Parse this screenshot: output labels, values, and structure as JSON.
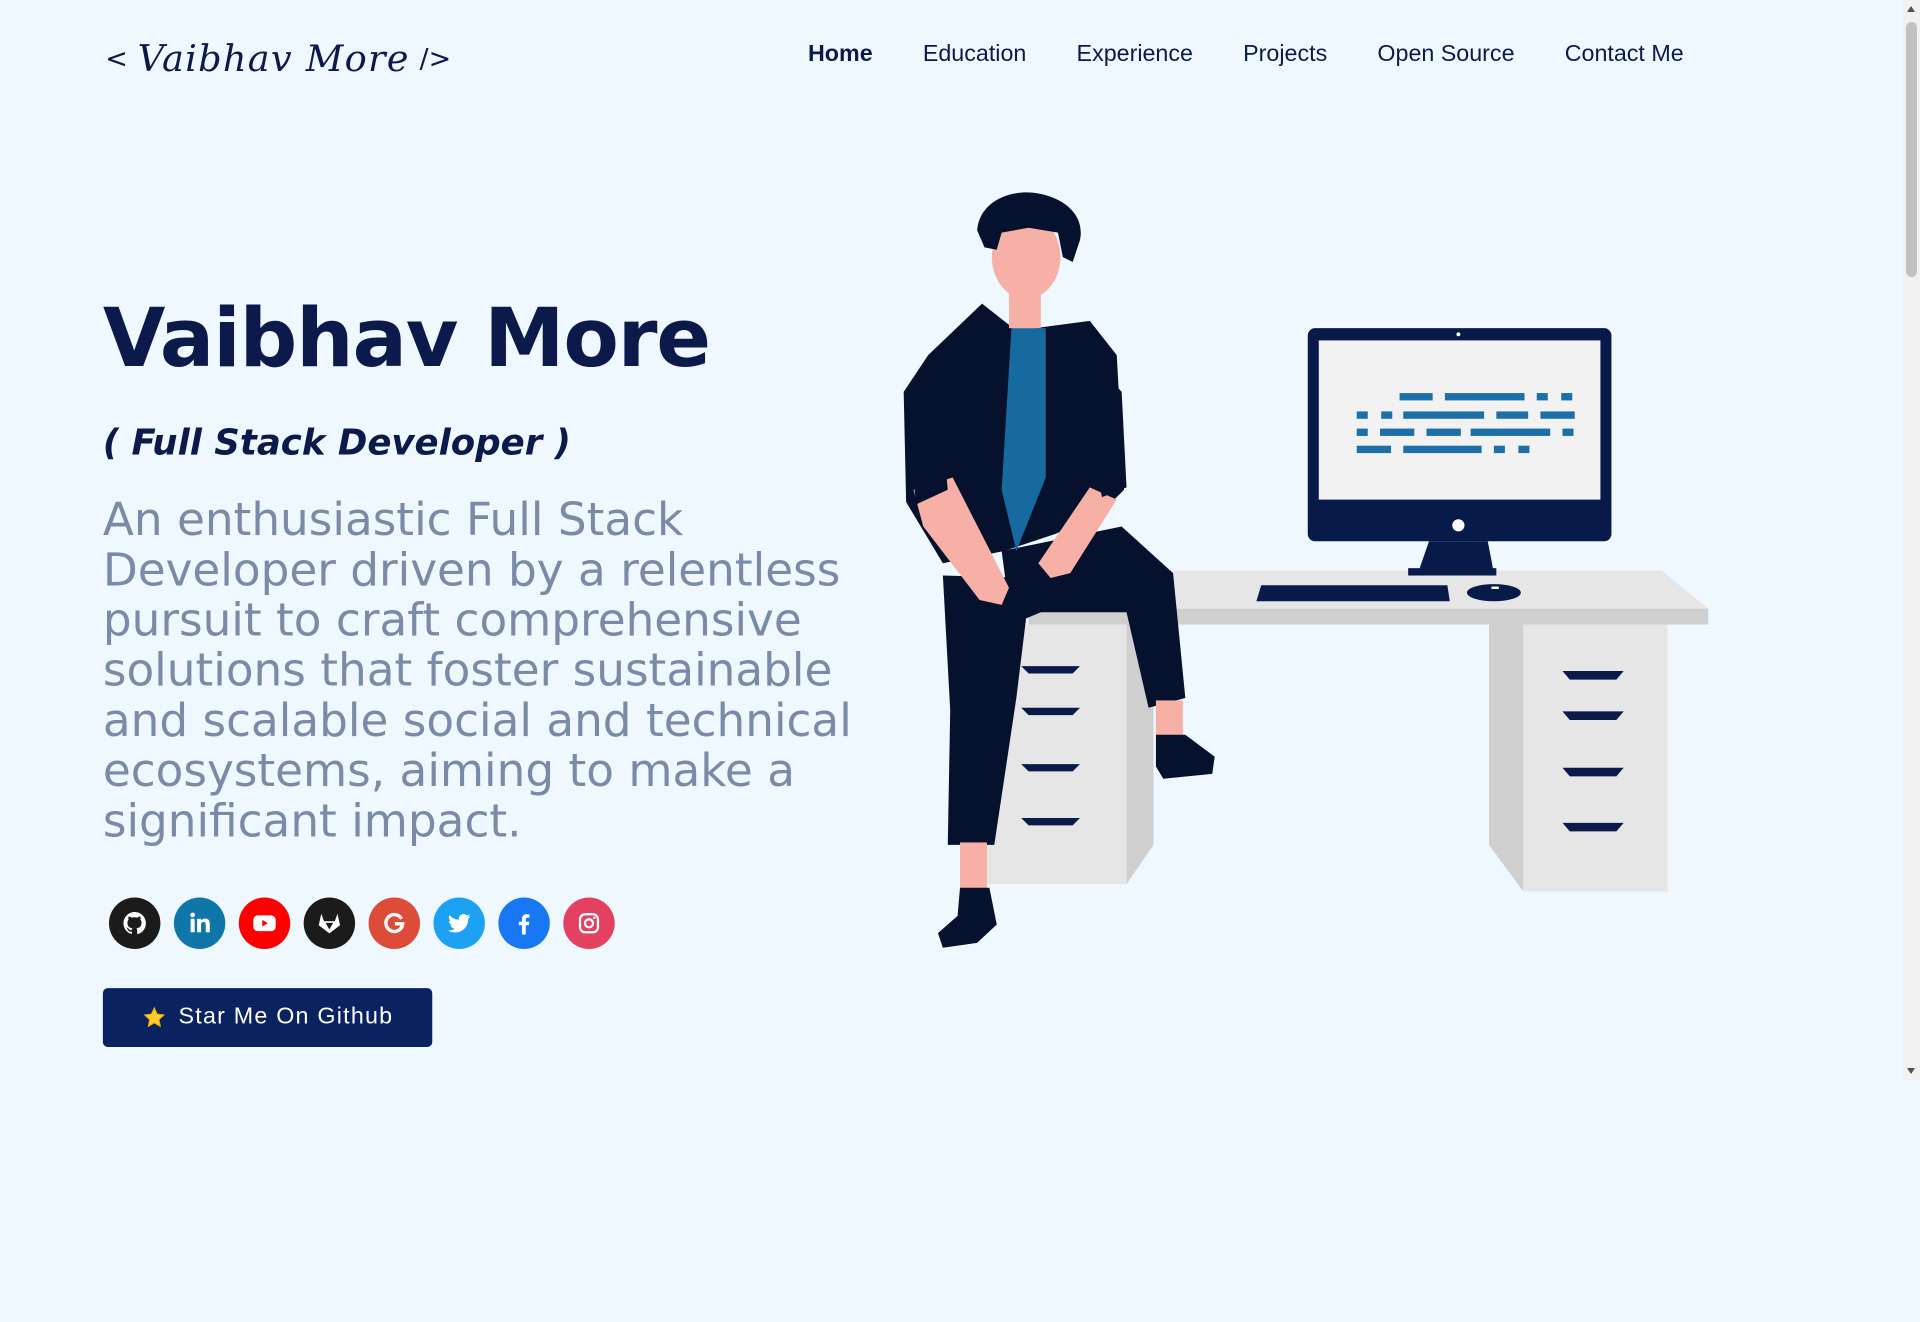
{
  "header": {
    "logo_open": "<",
    "logo_signature": "Vaibhav More",
    "logo_close": "/>",
    "nav": [
      "Home",
      "Education",
      "Experience",
      "Projects",
      "Open Source",
      "Contact Me"
    ]
  },
  "hero": {
    "name": "Vaibhav More",
    "role": "( Full Stack Developer )",
    "description": "An enthusiastic Full Stack Developer driven by a relentless pursuit to craft comprehensive solutions that foster sustainable and scalable social and technical ecosystems, aiming to make a significant impact."
  },
  "socials": [
    {
      "icon": "github-icon",
      "color": "#1b1b1b"
    },
    {
      "icon": "linkedin-icon",
      "color": "#0e76a8"
    },
    {
      "icon": "youtube-icon",
      "color": "#ff0000"
    },
    {
      "icon": "gitlab-icon",
      "color": "#1b1b1b"
    },
    {
      "icon": "google-icon",
      "color": "#dd4b39"
    },
    {
      "icon": "twitter-icon",
      "color": "#1da1f2"
    },
    {
      "icon": "facebook-icon",
      "color": "#1877f2"
    },
    {
      "icon": "instagram-icon",
      "color": "#e4405f"
    }
  ],
  "cta": {
    "label": "Star Me On Github",
    "icon": "star-icon"
  },
  "colors": {
    "background": "#eef8fe",
    "primary": "#0b1a4a",
    "muted_text": "#7b8aa6",
    "button": "#0b2260"
  }
}
